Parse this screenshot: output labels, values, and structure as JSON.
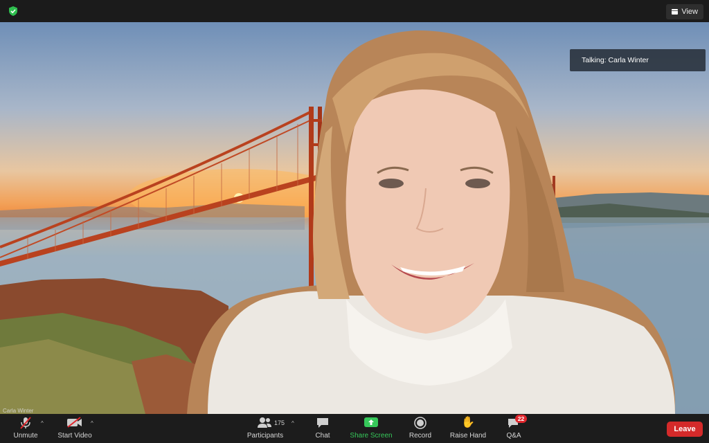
{
  "top_bar": {
    "view_label": "View"
  },
  "video": {
    "talking_label": "Talking: Carla Winter",
    "speaker_tag": "Carla Winter"
  },
  "toolbar": {
    "unmute_label": "Unmute",
    "start_video_label": "Start Video",
    "participants_label": "Participants",
    "participants_count": "175",
    "chat_label": "Chat",
    "share_screen_label": "Share Screen",
    "record_label": "Record",
    "raise_hand_label": "Raise Hand",
    "qa_label": "Q&A",
    "qa_badge": "22",
    "leave_label": "Leave"
  },
  "colors": {
    "share_green": "#36c85a",
    "leave_red": "#d42a2a",
    "badge_red": "#e0262c",
    "toolbar_bg": "#1c1c1c"
  },
  "icons": [
    "shield-check-icon",
    "grid-view-icon",
    "mic-muted-icon",
    "video-off-icon",
    "participants-icon",
    "chat-bubble-icon",
    "share-screen-arrow-icon",
    "record-icon",
    "raise-hand-icon",
    "qa-bubble-icon"
  ]
}
